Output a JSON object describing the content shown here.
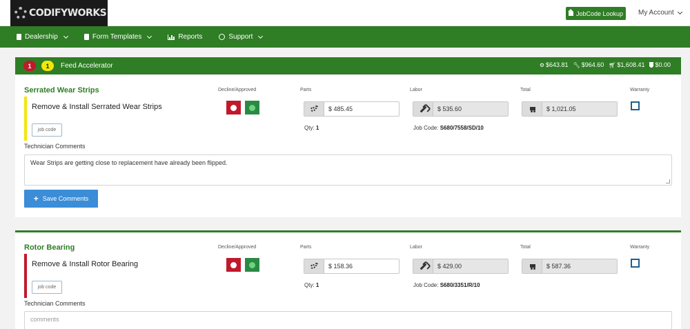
{
  "header": {
    "logo_text": "CODIFYWORKS",
    "jobcode_button": "JobCode Lookup",
    "account_label": "My Account"
  },
  "nav": {
    "items": [
      {
        "label": "Dealership",
        "icon": "document-icon"
      },
      {
        "label": "Form Templates",
        "icon": "document-icon"
      },
      {
        "label": "Reports",
        "icon": "bar-chart-icon"
      },
      {
        "label": "Support",
        "icon": "globe-icon"
      }
    ]
  },
  "section": {
    "badge_red": "1",
    "badge_yellow": "1",
    "title": "Feed Accelerator",
    "totals": {
      "parts": "$643.81",
      "labor": "$964.60",
      "total": "$1,608.41",
      "warranty": "$0.00"
    }
  },
  "labels": {
    "decline_approved": "Decline/Approved",
    "parts": "Parts",
    "labor": "Labor",
    "total": "Total",
    "warranty": "Warranty",
    "technician_comments": "Technician Comments",
    "job_code_chip": "job code",
    "qty_prefix": "Qty:",
    "job_code_prefix": "Job Code:",
    "save_comments": "Save Comments",
    "comments_placeholder": "comments"
  },
  "items": [
    {
      "title": "Serrated Wear Strips",
      "description": "Remove & Install Serrated Wear Strips",
      "status_color": "#f2e70a",
      "parts": "$ 485.45",
      "labor": "$ 535.60",
      "total": "$ 1,021.05",
      "qty": "1",
      "job_code": "S680/7558/SD/10",
      "comment": "Wear Strips are getting close to replacement have already been flipped."
    },
    {
      "title": "Rotor Bearing",
      "description": "Remove & Install Rotor Bearing",
      "status_color": "#c0192b",
      "parts": "$ 158.36",
      "labor": "$ 429.00",
      "total": "$ 587.36",
      "qty": "1",
      "job_code": "S680/3351/R/10",
      "comment": ""
    }
  ],
  "colors": {
    "brand_green": "#2f7d25",
    "decline_red": "#c0192b",
    "approve_green": "#2a8a45",
    "save_blue": "#3a8dd6"
  }
}
